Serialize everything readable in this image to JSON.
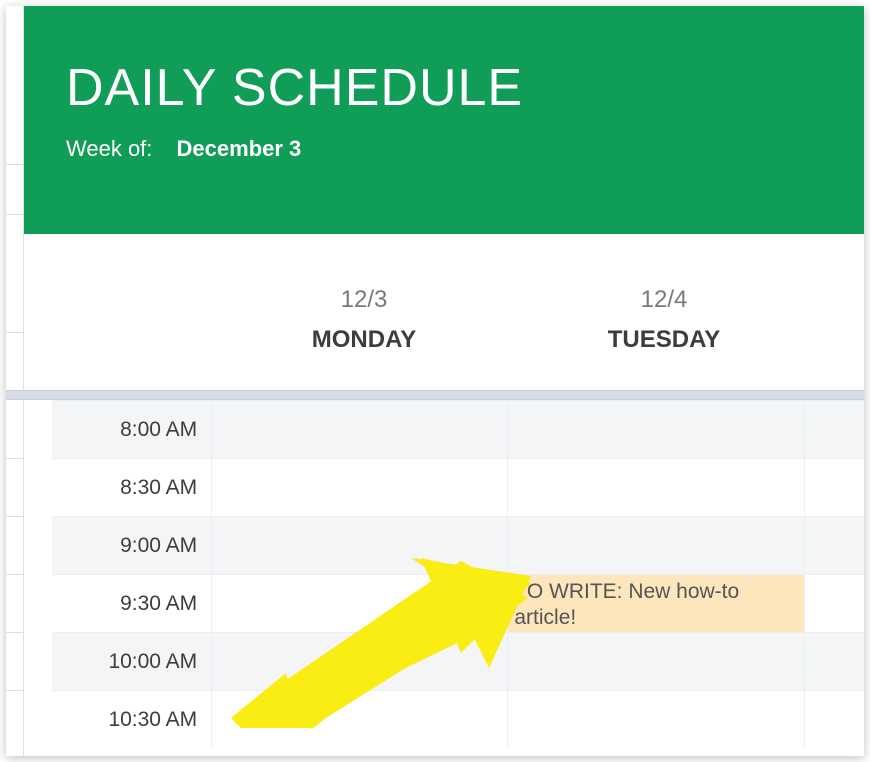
{
  "header": {
    "title": "DAILY SCHEDULE",
    "subtitle_label": "Week of:",
    "subtitle_value": "December 3"
  },
  "days": [
    {
      "date": "12/3",
      "name": "MONDAY"
    },
    {
      "date": "12/4",
      "name": "TUESDAY"
    }
  ],
  "time_slots": [
    "8:00 AM",
    "8:30 AM",
    "9:00 AM",
    "9:30 AM",
    "10:00 AM",
    "10:30 AM"
  ],
  "events": {
    "tuesday_930": "TO WRITE: New how-to article!"
  },
  "annotation": {
    "arrow_color": "#f9ed14"
  }
}
